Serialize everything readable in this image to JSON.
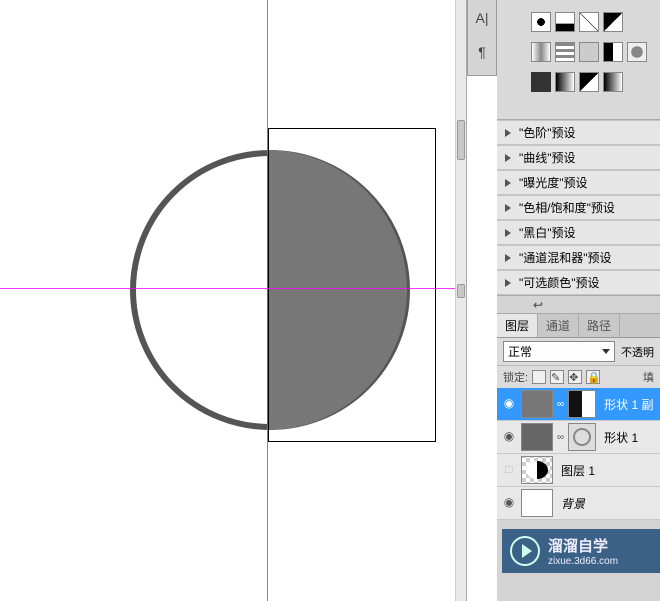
{
  "mini_toolbar": {
    "btn1": "A|",
    "btn2": "¶"
  },
  "presets": [
    "\"色阶\"预设",
    "\"曲线\"预设",
    "\"曝光度\"预设",
    "\"色相/饱和度\"预设",
    "\"黑白\"预设",
    "\"通道混和器\"预设",
    "\"可选颜色\"预设"
  ],
  "layers_panel": {
    "tabs": [
      "图层",
      "通道",
      "路径"
    ],
    "blend_mode": "正常",
    "opacity_label": "不透明",
    "lock_label": "锁定:",
    "fill_label": "填"
  },
  "layers": [
    {
      "name": "形状 1 副",
      "selected": true,
      "visible": true,
      "has_mask": true
    },
    {
      "name": "形状 1",
      "selected": false,
      "visible": true,
      "has_mask": true
    },
    {
      "name": "图层 1",
      "selected": false,
      "visible": false,
      "has_mask": false
    },
    {
      "name": "背景",
      "selected": false,
      "visible": true,
      "has_mask": false,
      "italic": true
    }
  ],
  "watermark": {
    "title": "溜溜自学",
    "sub": "zixue.3d66.com"
  }
}
